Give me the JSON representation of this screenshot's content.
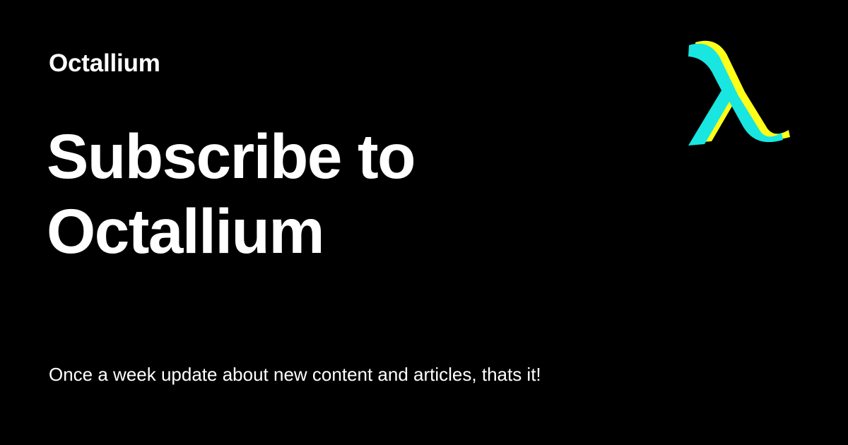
{
  "brand": {
    "site_name": "Octallium",
    "logo_icon": "lambda-logo-icon",
    "logo_colors": {
      "front": "#19e6e1",
      "shadow": "#ffff1a"
    }
  },
  "hero": {
    "headline_line1": "Subscribe to",
    "headline_line2": "Octallium",
    "tagline": "Once a week update about new content and articles, thats it!"
  },
  "colors": {
    "background": "#000000",
    "text": "#ffffff"
  }
}
